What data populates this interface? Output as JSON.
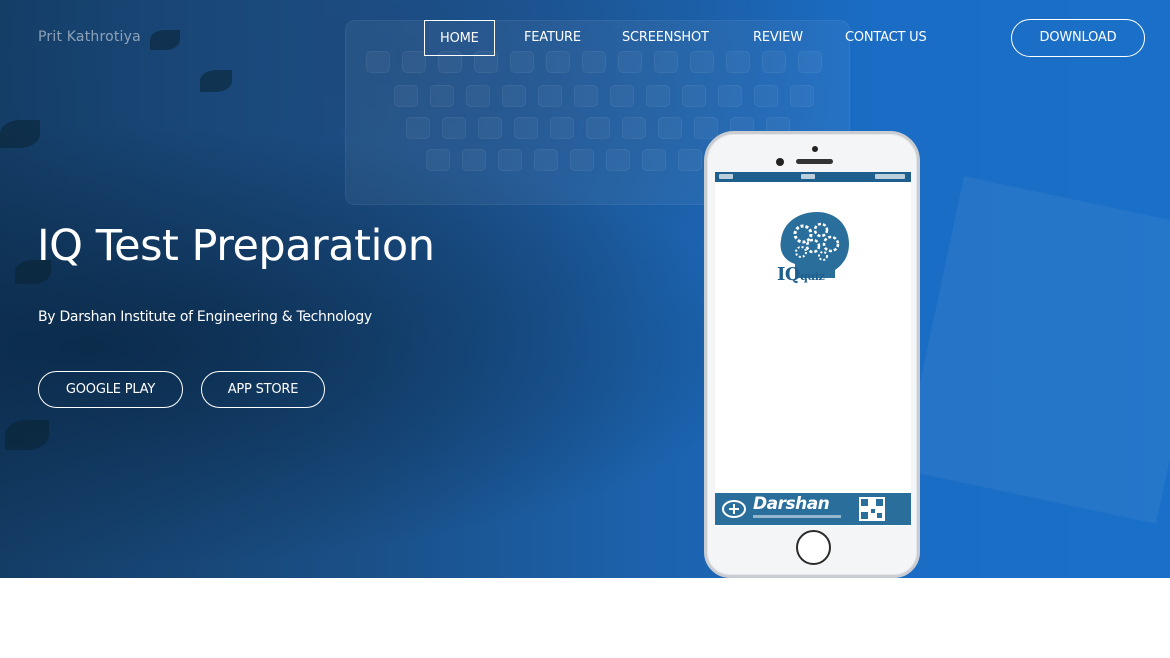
{
  "brand": {
    "name": "Prit Kathrotiya"
  },
  "nav": {
    "items": [
      {
        "label": "HOME",
        "active": true
      },
      {
        "label": "FEATURE",
        "active": false
      },
      {
        "label": "SCREENSHOT",
        "active": false
      },
      {
        "label": "REVIEW",
        "active": false
      },
      {
        "label": "CONTACT US",
        "active": false
      }
    ],
    "download_label": "DOWNLOAD"
  },
  "hero": {
    "title": "IQ Test Preparation",
    "subtitle": "By Darshan Institute of Engineering & Technology",
    "buttons": [
      {
        "label": "GOOGLE PLAY"
      },
      {
        "label": "APP STORE"
      }
    ]
  },
  "phone": {
    "app_logo_text": "IQ",
    "app_logo_subtext": "quiz",
    "banner_text": "Darshan"
  },
  "colors": {
    "hero_blue": "#1a6cc4",
    "hero_dark": "#143d66",
    "app_blue": "#2a6e9c",
    "white": "#ffffff"
  }
}
